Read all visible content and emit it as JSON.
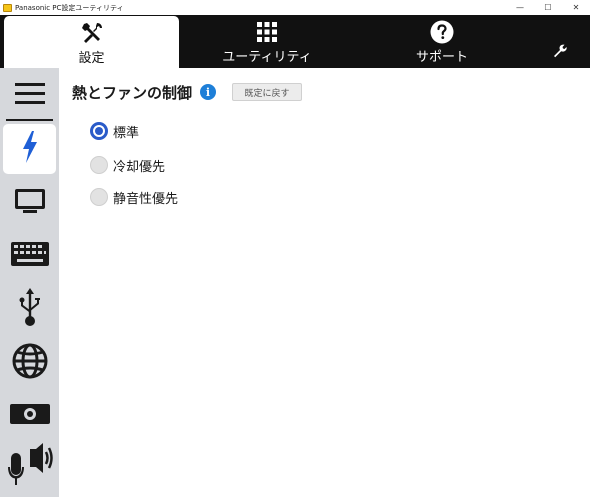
{
  "window": {
    "title": "Panasonic PC設定ユーティリティ",
    "controls": [
      "—",
      "☐",
      "✕"
    ]
  },
  "tabs": [
    {
      "label": "設定",
      "icon": "wrench-screwdriver-icon",
      "active": true
    },
    {
      "label": "ユーティリティ",
      "icon": "grid-icon",
      "active": false
    },
    {
      "label": "サポート",
      "icon": "help-icon",
      "active": false
    },
    {
      "label": "",
      "icon": "wrench-icon",
      "active": false
    }
  ],
  "sidebar": {
    "items": [
      {
        "icon": "menu-icon",
        "active": false
      },
      {
        "icon": "power-icon",
        "active": true
      },
      {
        "icon": "display-icon",
        "active": false
      },
      {
        "icon": "keyboard-icon",
        "active": false
      },
      {
        "icon": "usb-icon",
        "active": false
      },
      {
        "icon": "globe-icon",
        "active": false
      },
      {
        "icon": "camera-icon",
        "active": false
      },
      {
        "icon": "audio-icon",
        "active": false
      }
    ]
  },
  "main": {
    "heading": "熱とファンの制御",
    "info_glyph": "i",
    "reset_label": "既定に戻す",
    "options": [
      {
        "label": "標準",
        "checked": true
      },
      {
        "label": "冷却優先",
        "checked": false
      },
      {
        "label": "静音性優先",
        "checked": false
      }
    ]
  },
  "colors": {
    "topbar": "#111111",
    "sidebar": "#d6d8dc",
    "accent": "#2a5bc9",
    "info": "#1e7fd8"
  }
}
